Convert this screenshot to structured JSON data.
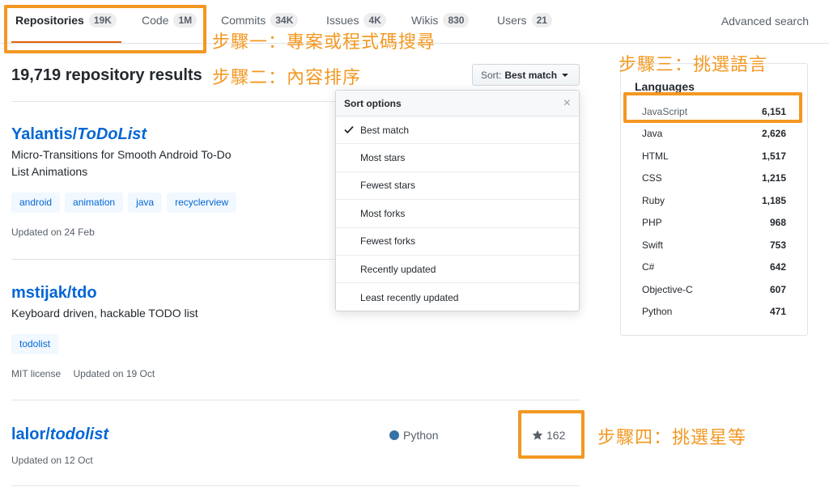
{
  "tabs": [
    {
      "label": "Repositories",
      "count": "19K"
    },
    {
      "label": "Code",
      "count": "1M"
    },
    {
      "label": "Commits",
      "count": "34K"
    },
    {
      "label": "Issues",
      "count": "4K"
    },
    {
      "label": "Wikis",
      "count": "830"
    },
    {
      "label": "Users",
      "count": "21"
    }
  ],
  "advanced_search": "Advanced search",
  "results_title": "19,719 repository results",
  "sort": {
    "prefix": "Sort:",
    "value": "Best match"
  },
  "dropdown": {
    "title": "Sort options",
    "close": "×",
    "options": [
      "Best match",
      "Most stars",
      "Fewest stars",
      "Most forks",
      "Fewest forks",
      "Recently updated",
      "Least recently updated"
    ]
  },
  "repos": [
    {
      "owner": "Yalantis/",
      "name": "ToDoList",
      "description_line1": "Micro-Transitions for Smooth Android To-Do",
      "description_line2": "List Animations",
      "topics": [
        "android",
        "animation",
        "java",
        "recyclerview"
      ],
      "updated": "Updated on 24 Feb"
    },
    {
      "owner": "mstijak/",
      "name": "tdo",
      "description_line1": "Keyboard driven, hackable TODO list",
      "topics": [
        "todolist"
      ],
      "license": "MIT license",
      "updated": "Updated on 19 Oct"
    },
    {
      "owner": "lalor/",
      "name": "todolist",
      "language": "Python",
      "stars": "162",
      "updated": "Updated on 12 Oct"
    }
  ],
  "languages": {
    "title": "Languages",
    "items": [
      {
        "name": "JavaScript",
        "count": "6,151"
      },
      {
        "name": "Java",
        "count": "2,626"
      },
      {
        "name": "HTML",
        "count": "1,517"
      },
      {
        "name": "CSS",
        "count": "1,215"
      },
      {
        "name": "Ruby",
        "count": "1,185"
      },
      {
        "name": "PHP",
        "count": "968"
      },
      {
        "name": "Swift",
        "count": "753"
      },
      {
        "name": "C#",
        "count": "642"
      },
      {
        "name": "Objective-C",
        "count": "607"
      },
      {
        "name": "Python",
        "count": "471"
      }
    ]
  },
  "annotations": {
    "step1": "步驟一：專案或程式碼搜尋",
    "step2": "步驟二：內容排序",
    "step3": "步驟三：挑選語言",
    "step4": "步驟四：挑選星等"
  },
  "colors": {
    "accent": "#f39822",
    "link": "#0366d6",
    "python": "#3572A5"
  }
}
